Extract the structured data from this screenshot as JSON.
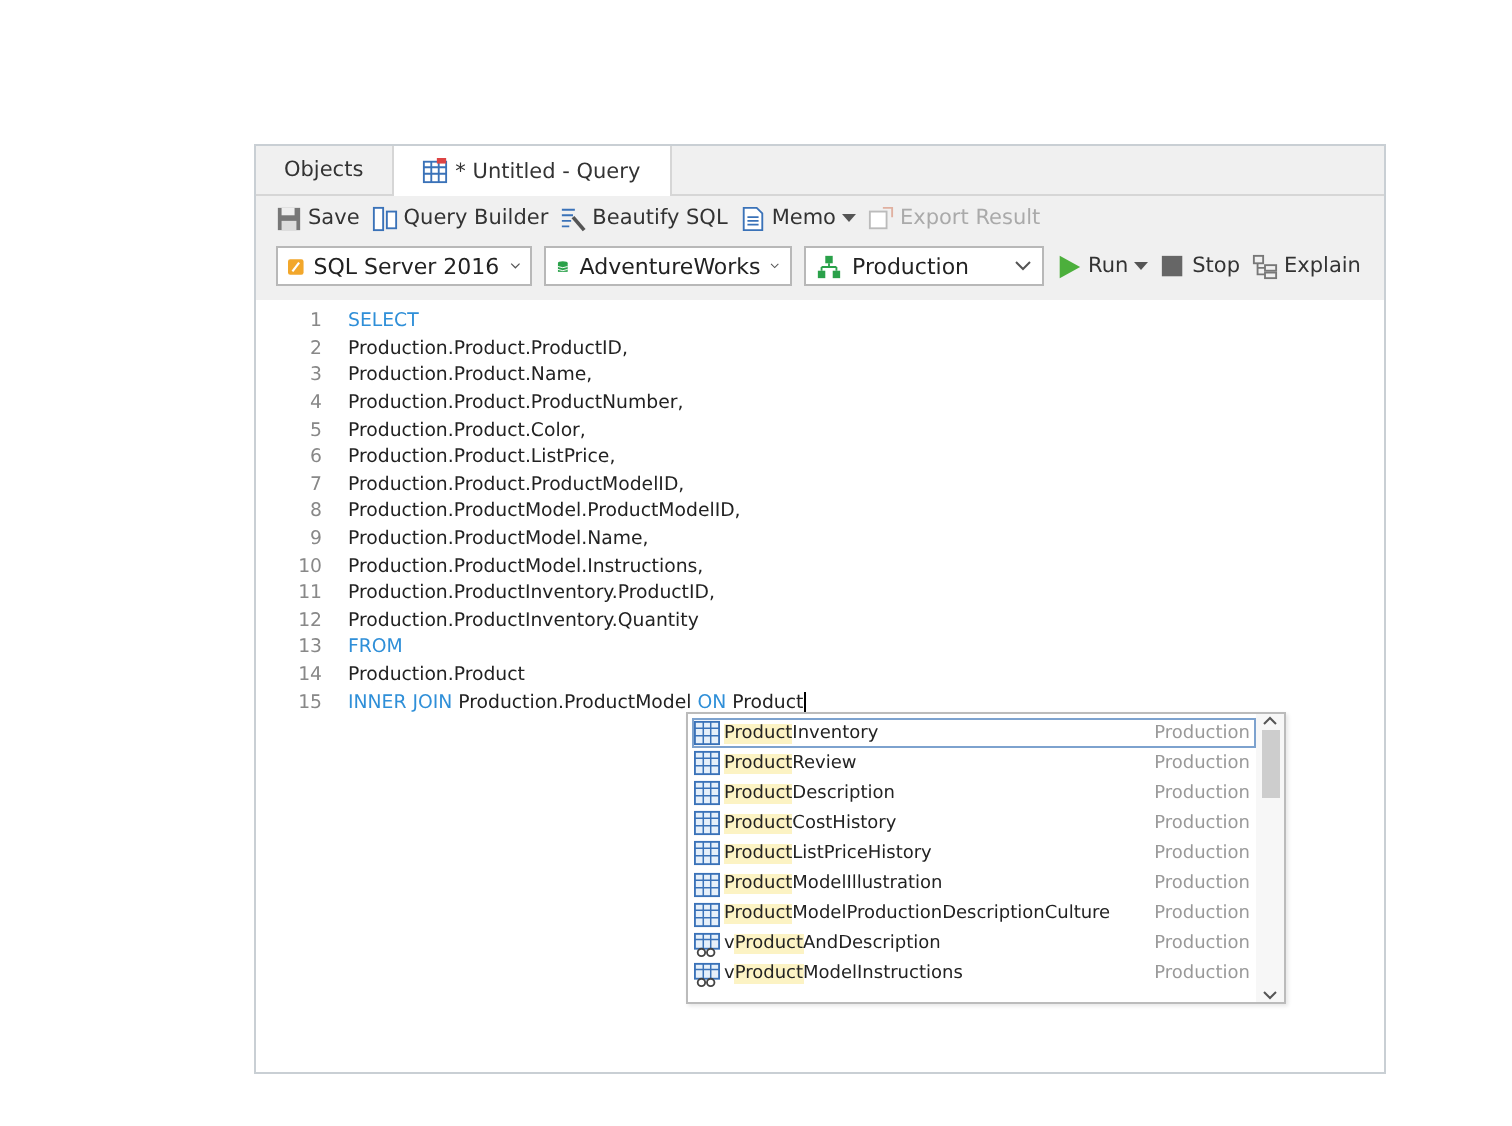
{
  "tabs": [
    {
      "label": "Objects",
      "selected": false,
      "kind": "plain"
    },
    {
      "label": "* Untitled - Query",
      "selected": true,
      "kind": "query"
    }
  ],
  "toolbar": [
    {
      "label": "Save",
      "disabled": false,
      "dropdown": false
    },
    {
      "label": "Query Builder",
      "disabled": false,
      "dropdown": false
    },
    {
      "label": "Beautify SQL",
      "disabled": false,
      "dropdown": false
    },
    {
      "label": "Memo",
      "disabled": false,
      "dropdown": true
    },
    {
      "label": "Export Result",
      "disabled": true,
      "dropdown": false
    }
  ],
  "selectors": [
    {
      "value": "SQL Server 2016"
    },
    {
      "value": "AdventureWorks"
    },
    {
      "value": "Production"
    }
  ],
  "run_controls": [
    {
      "label": "Run",
      "dropdown": true
    },
    {
      "label": "Stop",
      "dropdown": false
    },
    {
      "label": "Explain",
      "dropdown": false
    }
  ],
  "editor": {
    "lines": [
      {
        "number": "1",
        "tokens": [
          {
            "text": "SELECT",
            "kind": "keyword"
          }
        ]
      },
      {
        "number": "2",
        "tokens": [
          {
            "text": "Production.Product.ProductID,",
            "kind": "plain"
          }
        ]
      },
      {
        "number": "3",
        "tokens": [
          {
            "text": "Production.Product.Name,",
            "kind": "plain"
          }
        ]
      },
      {
        "number": "4",
        "tokens": [
          {
            "text": "Production.Product.ProductNumber,",
            "kind": "plain"
          }
        ]
      },
      {
        "number": "5",
        "tokens": [
          {
            "text": "Production.Product.Color,",
            "kind": "plain"
          }
        ]
      },
      {
        "number": "6",
        "tokens": [
          {
            "text": "Production.Product.ListPrice,",
            "kind": "plain"
          }
        ]
      },
      {
        "number": "7",
        "tokens": [
          {
            "text": "Production.Product.ProductModelID,",
            "kind": "plain"
          }
        ]
      },
      {
        "number": "8",
        "tokens": [
          {
            "text": "Production.ProductModel.ProductModelID,",
            "kind": "plain"
          }
        ]
      },
      {
        "number": "9",
        "tokens": [
          {
            "text": "Production.ProductModel.Name,",
            "kind": "plain"
          }
        ]
      },
      {
        "number": "10",
        "tokens": [
          {
            "text": "Production.ProductModel.Instructions,",
            "kind": "plain"
          }
        ]
      },
      {
        "number": "11",
        "tokens": [
          {
            "text": "Production.ProductInventory.ProductID,",
            "kind": "plain"
          }
        ]
      },
      {
        "number": "12",
        "tokens": [
          {
            "text": "Production.ProductInventory.Quantity",
            "kind": "plain"
          }
        ]
      },
      {
        "number": "13",
        "tokens": [
          {
            "text": "FROM",
            "kind": "keyword"
          }
        ]
      },
      {
        "number": "14",
        "tokens": [
          {
            "text": "Production.Product",
            "kind": "plain"
          }
        ]
      },
      {
        "number": "15",
        "tokens": [
          {
            "text": "INNER JOIN",
            "kind": "keyword"
          },
          {
            "text": "Production.ProductModel",
            "kind": "plain"
          },
          {
            "text": "ON",
            "kind": "keyword"
          },
          {
            "text": "Product",
            "kind": "plain"
          }
        ],
        "cursor": true
      }
    ]
  },
  "autocomplete": {
    "items": [
      {
        "kind": "table",
        "match": "Product",
        "rest": "Inventory",
        "schema": "Production",
        "selected": true
      },
      {
        "kind": "table",
        "match": "Product",
        "rest": "Review",
        "schema": "Production",
        "selected": false
      },
      {
        "kind": "table",
        "match": "Product",
        "rest": "Description",
        "schema": "Production",
        "selected": false
      },
      {
        "kind": "table",
        "match": "Product",
        "rest": "CostHistory",
        "schema": "Production",
        "selected": false
      },
      {
        "kind": "table",
        "match": "Product",
        "rest": "ListPriceHistory",
        "schema": "Production",
        "selected": false
      },
      {
        "kind": "table",
        "match": "Product",
        "rest": "ModelIllustration",
        "schema": "Production",
        "selected": false
      },
      {
        "kind": "table",
        "match": "Product",
        "rest": "ModelProductionDescriptionCulture",
        "schema": "Production",
        "selected": false
      },
      {
        "kind": "view",
        "prefix": "v",
        "match": "Product",
        "rest": "AndDescription",
        "schema": "Production",
        "selected": false
      },
      {
        "kind": "view",
        "prefix": "v",
        "match": "Product",
        "rest": "ModelInstructions",
        "schema": "Production",
        "selected": false
      }
    ]
  }
}
